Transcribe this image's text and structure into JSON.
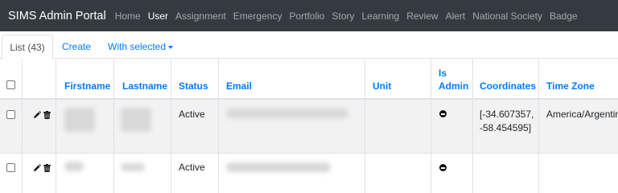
{
  "navbar": {
    "brand": "SIMS Admin Portal",
    "items": [
      {
        "label": "Home",
        "active": false
      },
      {
        "label": "User",
        "active": true
      },
      {
        "label": "Assignment",
        "active": false
      },
      {
        "label": "Emergency",
        "active": false
      },
      {
        "label": "Portfolio",
        "active": false
      },
      {
        "label": "Story",
        "active": false
      },
      {
        "label": "Learning",
        "active": false
      },
      {
        "label": "Review",
        "active": false
      },
      {
        "label": "Alert",
        "active": false
      },
      {
        "label": "National Society",
        "active": false
      },
      {
        "label": "Badge",
        "active": false
      }
    ]
  },
  "tabs": {
    "list": "List (43)",
    "create": "Create",
    "with_selected": "With selected"
  },
  "table": {
    "headers": {
      "firstname": "Firstname",
      "lastname": "Lastname",
      "status": "Status",
      "email": "Email",
      "unit": "Unit",
      "is_admin_1": "Is",
      "is_admin_2": "Admin",
      "coordinates": "Coordinates",
      "time_zone": "Time Zone"
    },
    "rows": [
      {
        "status": "Active",
        "coordinates_1": "[-34.607357,",
        "coordinates_2": "-58.454595]",
        "time_zone": "America/Argentina"
      },
      {
        "status": "Active",
        "coordinates_1": "",
        "coordinates_2": "",
        "time_zone": ""
      }
    ]
  },
  "colors": {
    "navbar_bg": "#343a40",
    "link": "#007bff",
    "row_stripe": "#f2f2f2"
  }
}
